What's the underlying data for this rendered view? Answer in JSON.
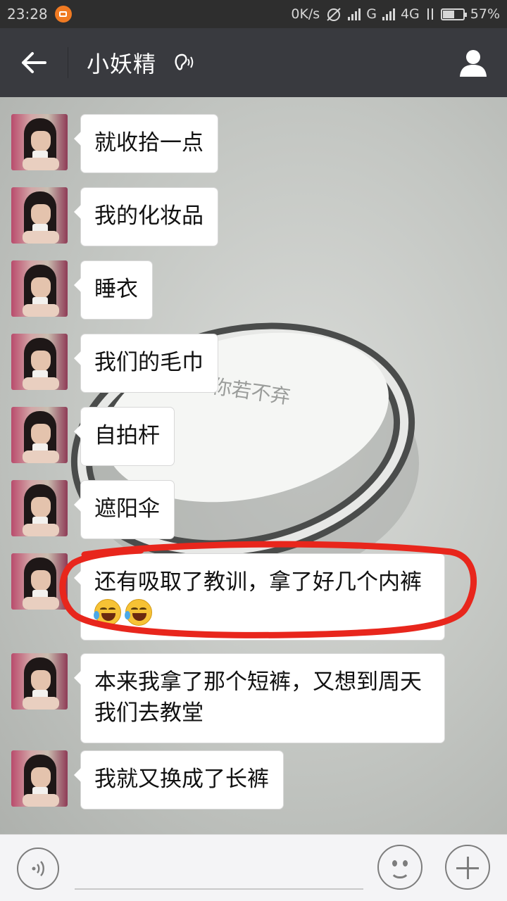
{
  "status_bar": {
    "time": "23:28",
    "net_speed": "0K/s",
    "sig1_label": "G",
    "sig2_label": "4G",
    "battery_pct": "57%",
    "battery_level": 0.57
  },
  "header": {
    "title": "小妖精",
    "back_icon": "arrow-left-icon",
    "mode_icon": "earpiece-icon",
    "profile_icon": "person-icon"
  },
  "messages": [
    {
      "text": "就收拾一点"
    },
    {
      "text": "我的化妆品"
    },
    {
      "text": "睡衣"
    },
    {
      "text": "我们的毛巾"
    },
    {
      "text": "自拍杆"
    },
    {
      "text": "遮阳伞"
    },
    {
      "text": "还有吸取了教训，拿了好几个内裤",
      "emojis": [
        "laugh-tears-emoji",
        "laugh-tears-emoji"
      ]
    },
    {
      "text": "本来我拿了那个短裤，又想到周天我们去教堂"
    },
    {
      "text": "我就又换成了长裤"
    }
  ],
  "background": {
    "engraving": "你若不弃"
  },
  "input_bar": {
    "voice_icon": "voice-icon",
    "emoji_icon": "emoji-icon",
    "plus_icon": "plus-icon",
    "input_value": ""
  },
  "colors": {
    "title_bar": "#393a3f",
    "status_bar": "#2e2e2e",
    "annotation_red": "#e8261c"
  }
}
